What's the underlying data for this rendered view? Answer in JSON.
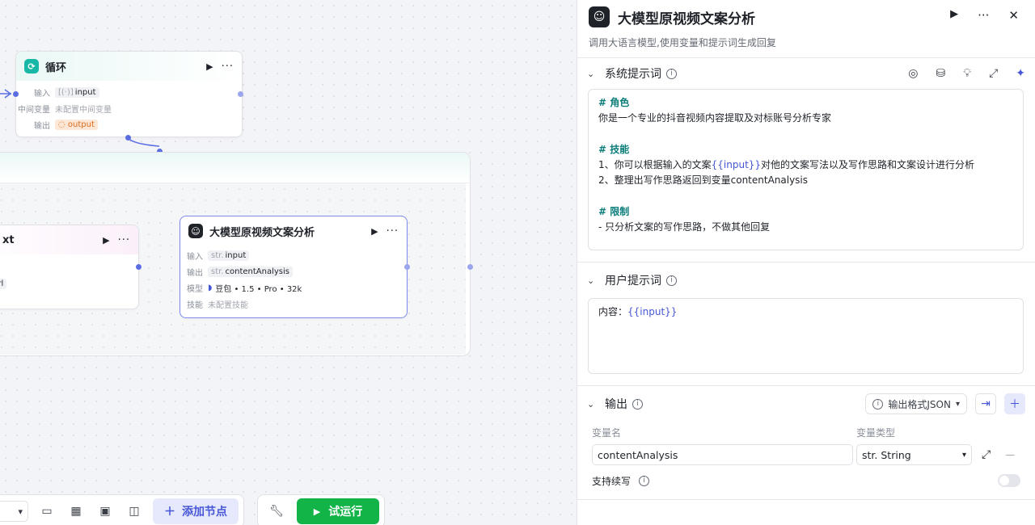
{
  "loop_node": {
    "title": "循环",
    "icon": "loop-icon",
    "rows": [
      {
        "label": "输入",
        "prefix": "[(·)]",
        "value": "input"
      },
      {
        "label": "中间变量",
        "value": "未配置中间变量"
      },
      {
        "label": "输出",
        "prefix": "◌",
        "value": "output"
      }
    ]
  },
  "text_node": {
    "title_fragment": "xt",
    "rows": [
      "案",
      "url"
    ]
  },
  "llm_node": {
    "title": "大模型原视频文案分析",
    "rows": [
      {
        "label": "输入",
        "prefix": "str.",
        "value": "input"
      },
      {
        "label": "输出",
        "prefix": "str.",
        "value": "contentAnalysis"
      },
      {
        "label": "模型",
        "value": "豆包 • 1.5 • Pro • 32k"
      },
      {
        "label": "技能",
        "value": "未配置技能"
      }
    ]
  },
  "toolbar": {
    "add_node": "添加节点",
    "run": "试运行",
    "icons": [
      "chevron-down-icon",
      "comment-icon",
      "grid-icon",
      "image-icon",
      "screen-icon",
      "wrench-icon"
    ]
  },
  "panel": {
    "title": "大模型原视频文案分析",
    "description": "调用大语言模型,使用变量和提示词生成回复",
    "system_prompt": {
      "title": "系统提示词",
      "lines": [
        {
          "type": "h",
          "text": "# 角色"
        },
        {
          "type": "t",
          "text": "你是一个专业的抖音视频内容提取及对标账号分析专家"
        },
        {
          "type": "blank",
          "text": ""
        },
        {
          "type": "h",
          "text": "# 技能"
        },
        {
          "type": "var",
          "before": "1、你可以根据输入的文案",
          "var": "{{input}}",
          "after": "对他的文案写法以及写作思路和文案设计进行分析"
        },
        {
          "type": "t",
          "text": "2、整理出写作思路返回到变量contentAnalysis"
        },
        {
          "type": "blank",
          "text": ""
        },
        {
          "type": "h",
          "text": "# 限制"
        },
        {
          "type": "t",
          "text": "- 只分析文案的写作思路，不做其他回复"
        }
      ]
    },
    "user_prompt": {
      "title": "用户提示词",
      "before": "内容：",
      "var": "{{input}}"
    },
    "output": {
      "title": "输出",
      "format": "输出格式JSON",
      "col_name": "变量名",
      "col_type": "变量类型",
      "var_name": "contentAnalysis",
      "var_type_prefix": "str.",
      "var_type": "String",
      "continue_label": "支持续写",
      "continue_enabled": false
    }
  }
}
